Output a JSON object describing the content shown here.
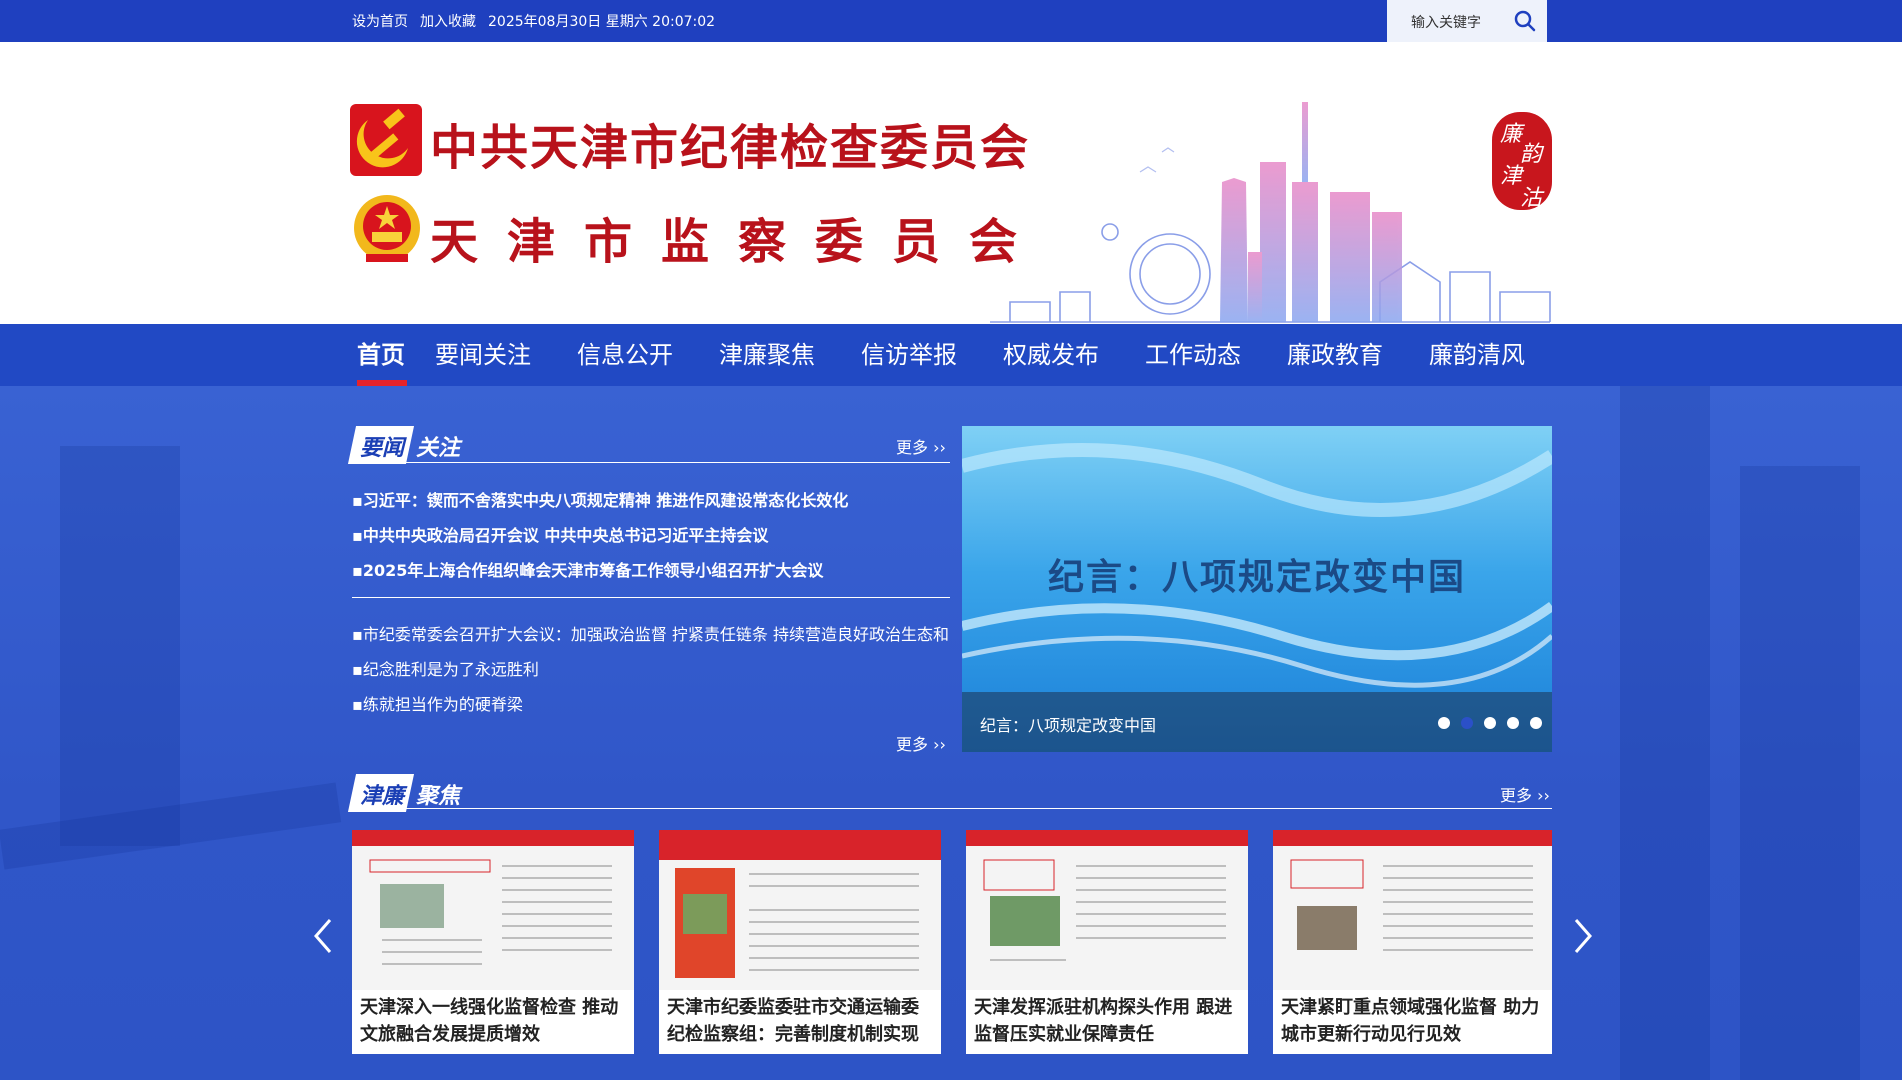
{
  "topbar": {
    "set_home": "设为首页",
    "favorite": "加入收藏",
    "datetime": "2025年08月30日 星期六 20:07:02",
    "search_placeholder": "输入关键字"
  },
  "header": {
    "title_line1": "中共天津市纪律检查委员会",
    "title_line2": "天津市监察委员会",
    "seal_text": [
      "廉",
      "韵",
      "津",
      "沽"
    ]
  },
  "nav": {
    "items": [
      "首页",
      "要闻关注",
      "信息公开",
      "津廉聚焦",
      "信访举报",
      "权威发布",
      "工作动态",
      "廉政教育",
      "廉韵清风"
    ]
  },
  "news_section": {
    "title_a": "要闻",
    "title_b": "关注",
    "more": "更多 ››",
    "headlines": [
      "▪习近平：锲而不舍落实中央八项规定精神 推进作风建设常态化长效化",
      "▪中共中央政治局召开会议 中共中央总书记习近平主持会议",
      "▪2025年上海合作组织峰会天津市筹备工作领导小组召开扩大会议"
    ],
    "items": [
      "▪市纪委常委会召开扩大会议：加强政治监督 拧紧责任链条 持续营造良好政治生态和",
      "▪纪念胜利是为了永远胜利",
      "▪练就担当作为的硬脊梁"
    ],
    "more_bottom": "更多 ››"
  },
  "slider": {
    "headline": "纪言：八项规定改变中国",
    "caption": "纪言：八项规定改变中国",
    "active_index": 1,
    "dot_count": 5
  },
  "focus_section": {
    "title_a": "津廉",
    "title_b": "聚焦",
    "more": "更多 ››",
    "cards": [
      {
        "caption": "天津深入一线强化监督检查 推动文旅融合发展提质增效"
      },
      {
        "caption": "天津市纪委监委驻市交通运输委纪检监察组：完善制度机制实现"
      },
      {
        "caption": "天津发挥派驻机构探头作用 跟进监督压实就业保障责任"
      },
      {
        "caption": "天津紧盯重点领域强化监督 助力城市更新行动见行见效"
      }
    ]
  },
  "colors": {
    "primary_blue": "#1f40bf",
    "nav_blue": "#2149c4",
    "title_red": "#b8121b",
    "active_underline": "#e5232a"
  }
}
